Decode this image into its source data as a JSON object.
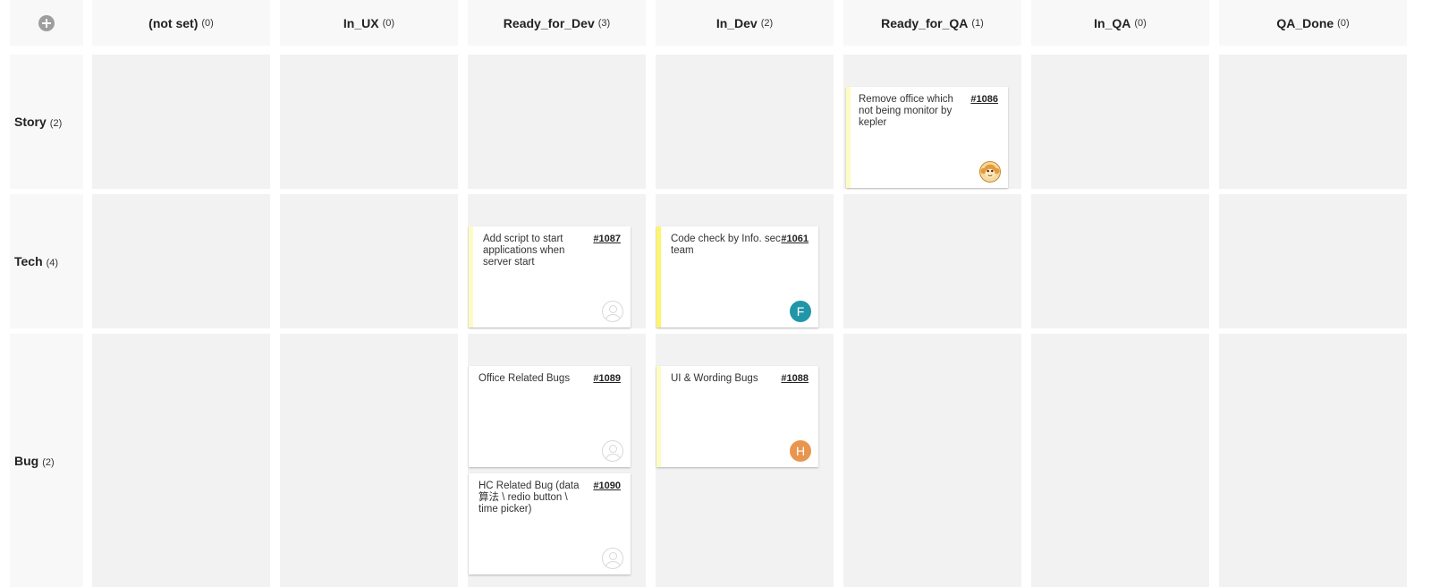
{
  "board": {
    "add_icon": "plus-circle-icon",
    "columns": [
      {
        "name": "(not set)",
        "count": "(0)"
      },
      {
        "name": "In_UX",
        "count": "(0)"
      },
      {
        "name": "Ready_for_Dev",
        "count": "(3)"
      },
      {
        "name": "In_Dev",
        "count": "(2)"
      },
      {
        "name": "Ready_for_QA",
        "count": "(1)"
      },
      {
        "name": "In_QA",
        "count": "(0)"
      },
      {
        "name": "QA_Done",
        "count": "(0)"
      }
    ],
    "rows": [
      {
        "name": "Story",
        "count": "(2)"
      },
      {
        "name": "Tech",
        "count": "(4)"
      },
      {
        "name": "Bug",
        "count": "(2)"
      }
    ],
    "cards": [
      {
        "title": "Remove office which not being monitor by kepler",
        "number": "#1086",
        "avatar": {
          "type": "monkey-avatar",
          "letter": ""
        }
      },
      {
        "title": "Add script to start applications when server start",
        "number": "#1087",
        "avatar": {
          "type": "empty-avatar",
          "letter": ""
        }
      },
      {
        "title": "Code check by Info. sec team",
        "number": "#1061",
        "avatar": {
          "type": "letter",
          "letter": "F",
          "color": "#2196a8"
        }
      },
      {
        "title": "Office Related Bugs",
        "number": "#1089",
        "avatar": {
          "type": "empty-avatar",
          "letter": ""
        }
      },
      {
        "title": "UI & Wording Bugs",
        "number": "#1088",
        "avatar": {
          "type": "letter",
          "letter": "H",
          "color": "#e8954e"
        }
      },
      {
        "title": "HC Related Bug (data 算法 \\ redio button \\ time picker)",
        "number": "#1090",
        "avatar": {
          "type": "empty-avatar",
          "letter": ""
        }
      }
    ],
    "stripe_colors": {
      "light": "#fdfbc4",
      "bright": "#fff56a"
    }
  }
}
